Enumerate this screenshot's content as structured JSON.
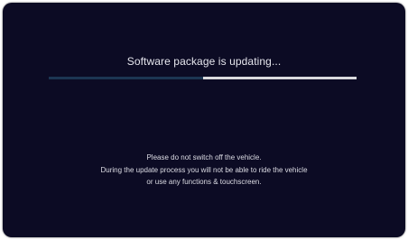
{
  "update_screen": {
    "title": "Software package is updating...",
    "progress": 0.5,
    "colors": {
      "background": "#0c0b24",
      "progress_fill": "#1c3552",
      "progress_track": "#d9d9dd"
    },
    "notice": [
      "Please do not switch off the vehicle.",
      "During the update process you will not be able to ride the vehicle",
      "or use any functions & touchscreen."
    ]
  }
}
